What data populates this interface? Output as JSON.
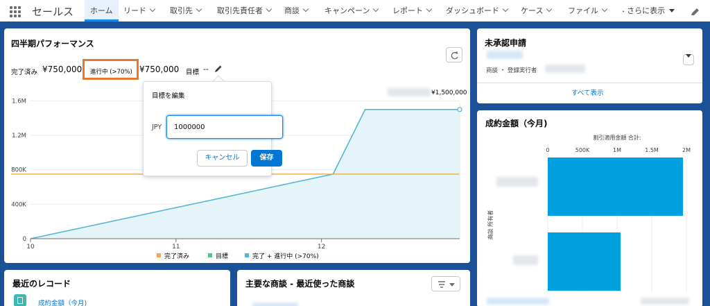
{
  "app": {
    "name": "セールス"
  },
  "nav": {
    "home": "ホーム",
    "leads": "リード",
    "accounts": "取引先",
    "contacts": "取引先責任者",
    "opportunities": "商談",
    "campaigns": "キャンペーン",
    "reports": "レポート",
    "dashboards": "ダッシュボード",
    "cases": "ケース",
    "files": "ファイル",
    "more": "さらに表示"
  },
  "performance": {
    "title": "四半期パフォーマンス",
    "closed_label": "完了済み",
    "closed_value": "¥750,000",
    "open_label": "進行中 (>70%)",
    "open_value": "¥750,000",
    "goal_label": "目標",
    "goal_value": "--",
    "tooltip_value": "¥1,500,000",
    "popover": {
      "title": "目標を編集",
      "currency": "JPY",
      "input_value": "1000000",
      "cancel": "キャンセル",
      "save": "保存"
    },
    "legend": {
      "closed": "完了済み",
      "goal": "目標",
      "closed_open": "完了 + 進行中 (>70%)"
    }
  },
  "chart_data": [
    {
      "type": "line",
      "x_ticks": [
        "10",
        "11",
        "12"
      ],
      "y_ticks": [
        "0",
        "400K",
        "800K",
        "1.2M",
        "1.6M"
      ],
      "ylim": [
        0,
        1700000
      ],
      "goal": 750000,
      "series": [
        {
          "name": "完了 + 進行中 (>70%)",
          "points": [
            [
              10.0,
              0
            ],
            [
              12.08,
              750000
            ],
            [
              12.3,
              1500000
            ],
            [
              12.95,
              1500000
            ]
          ]
        },
        {
          "name": "完了済み",
          "points": [
            [
              10.0,
              0
            ],
            [
              12.08,
              750000
            ]
          ]
        }
      ],
      "colors": {
        "closed_open": "#54b6d6",
        "goal": "#f2a84a",
        "closed": "#f2a84a",
        "goal_legend": "#4bca81"
      }
    },
    {
      "type": "bar",
      "title": "割引適用金額 合計:",
      "xlabel": "割引適用金額 合計:",
      "ylabel": "商談 所有者",
      "x_ticks": [
        "0",
        "500K",
        "1M",
        "1.5M",
        "2M"
      ],
      "xlim": [
        0,
        2000000
      ],
      "values": [
        1950000,
        1050000
      ],
      "color": "#00a1e0"
    }
  ],
  "approvals": {
    "title": "未承認申請",
    "meta": "商談 ・ 登録実行者",
    "view_all": "すべて表示"
  },
  "won": {
    "title": "成約金額（今月)"
  },
  "recent": {
    "title": "最近のレコード",
    "item1": "成約金額（今月)"
  },
  "key_deals": {
    "title": "主要な商談 - 最近使った商談"
  },
  "colors": {
    "brand": "#0176d3",
    "nav_bg": "#1b5297",
    "highlight_box": "#e8782e"
  }
}
